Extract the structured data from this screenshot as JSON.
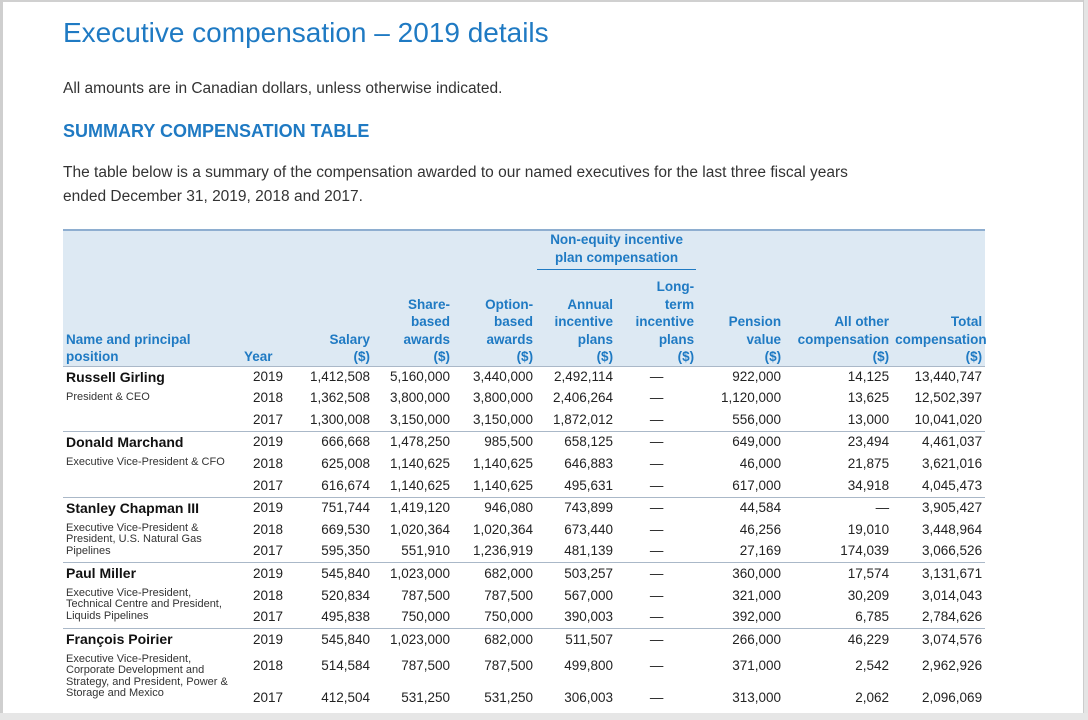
{
  "page": {
    "title": "Executive compensation – 2019 details",
    "note": "All amounts are in Canadian dollars, unless otherwise indicated.",
    "section_heading": "SUMMARY COMPENSATION TABLE",
    "intro": "The table below is a summary of the compensation awarded to our named executives for the last three fiscal years ended December 31, 2019, 2018 and 2017."
  },
  "table": {
    "group_header": "Non-equity incentive plan compensation",
    "columns": {
      "name": "Name and principal position",
      "year": "Year",
      "salary": "Salary ($)",
      "share": "Share-based awards ($)",
      "option": "Option-based awards ($)",
      "annual": "Annual incentive plans ($)",
      "longterm": "Long-term incentive plans ($)",
      "pension": "Pension value ($)",
      "other": "All other compensation ($)",
      "total": "Total compensation ($)"
    },
    "executives": [
      {
        "name": "Russell Girling",
        "title": "President & CEO",
        "rows": [
          {
            "year": "2019",
            "salary": "1,412,508",
            "share": "5,160,000",
            "option": "3,440,000",
            "annual": "2,492,114",
            "longterm": "—",
            "pension": "922,000",
            "other": "14,125",
            "total": "13,440,747"
          },
          {
            "year": "2018",
            "salary": "1,362,508",
            "share": "3,800,000",
            "option": "3,800,000",
            "annual": "2,406,264",
            "longterm": "—",
            "pension": "1,120,000",
            "other": "13,625",
            "total": "12,502,397"
          },
          {
            "year": "2017",
            "salary": "1,300,008",
            "share": "3,150,000",
            "option": "3,150,000",
            "annual": "1,872,012",
            "longterm": "—",
            "pension": "556,000",
            "other": "13,000",
            "total": "10,041,020"
          }
        ]
      },
      {
        "name": "Donald Marchand",
        "title": "Executive Vice-President & CFO",
        "rows": [
          {
            "year": "2019",
            "salary": "666,668",
            "share": "1,478,250",
            "option": "985,500",
            "annual": "658,125",
            "longterm": "—",
            "pension": "649,000",
            "other": "23,494",
            "total": "4,461,037"
          },
          {
            "year": "2018",
            "salary": "625,008",
            "share": "1,140,625",
            "option": "1,140,625",
            "annual": "646,883",
            "longterm": "—",
            "pension": "46,000",
            "other": "21,875",
            "total": "3,621,016"
          },
          {
            "year": "2017",
            "salary": "616,674",
            "share": "1,140,625",
            "option": "1,140,625",
            "annual": "495,631",
            "longterm": "—",
            "pension": "617,000",
            "other": "34,918",
            "total": "4,045,473"
          }
        ]
      },
      {
        "name": "Stanley Chapman III",
        "title": "Executive Vice-President & President, U.S. Natural Gas Pipelines",
        "rows": [
          {
            "year": "2019",
            "salary": "751,744",
            "share": "1,419,120",
            "option": "946,080",
            "annual": "743,899",
            "longterm": "—",
            "pension": "44,584",
            "other": "—",
            "total": "3,905,427"
          },
          {
            "year": "2018",
            "salary": "669,530",
            "share": "1,020,364",
            "option": "1,020,364",
            "annual": "673,440",
            "longterm": "—",
            "pension": "46,256",
            "other": "19,010",
            "total": "3,448,964"
          },
          {
            "year": "2017",
            "salary": "595,350",
            "share": "551,910",
            "option": "1,236,919",
            "annual": "481,139",
            "longterm": "—",
            "pension": "27,169",
            "other": "174,039",
            "total": "3,066,526"
          }
        ]
      },
      {
        "name": "Paul Miller",
        "title": "Executive Vice-President, Technical Centre and President, Liquids Pipelines",
        "rows": [
          {
            "year": "2019",
            "salary": "545,840",
            "share": "1,023,000",
            "option": "682,000",
            "annual": "503,257",
            "longterm": "—",
            "pension": "360,000",
            "other": "17,574",
            "total": "3,131,671"
          },
          {
            "year": "2018",
            "salary": "520,834",
            "share": "787,500",
            "option": "787,500",
            "annual": "567,000",
            "longterm": "—",
            "pension": "321,000",
            "other": "30,209",
            "total": "3,014,043"
          },
          {
            "year": "2017",
            "salary": "495,838",
            "share": "750,000",
            "option": "750,000",
            "annual": "390,003",
            "longterm": "—",
            "pension": "392,000",
            "other": "6,785",
            "total": "2,784,626"
          }
        ]
      },
      {
        "name": "François Poirier",
        "title": "Executive Vice-President, Corporate Development and Strategy, and President, Power & Storage and Mexico",
        "rows": [
          {
            "year": "2019",
            "salary": "545,840",
            "share": "1,023,000",
            "option": "682,000",
            "annual": "511,507",
            "longterm": "—",
            "pension": "266,000",
            "other": "46,229",
            "total": "3,074,576"
          },
          {
            "year": "2018",
            "salary": "514,584",
            "share": "787,500",
            "option": "787,500",
            "annual": "499,800",
            "longterm": "—",
            "pension": "371,000",
            "other": "2,542",
            "total": "2,962,926"
          },
          {
            "year": "2017",
            "salary": "412,504",
            "share": "531,250",
            "option": "531,250",
            "annual": "306,003",
            "longterm": "—",
            "pension": "313,000",
            "other": "2,062",
            "total": "2,096,069"
          }
        ]
      }
    ]
  }
}
